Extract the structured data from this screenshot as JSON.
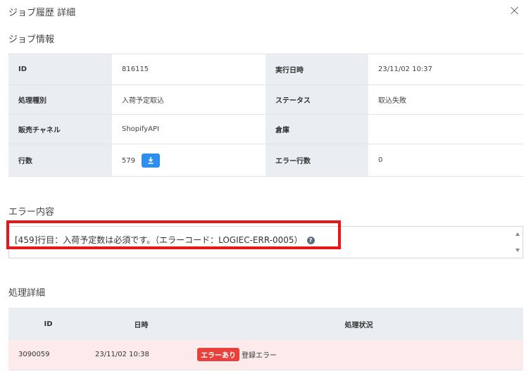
{
  "modal": {
    "title": "ジョブ履歴 詳細"
  },
  "job_info": {
    "section_title": "ジョブ情報",
    "rows": [
      {
        "label1": "ID",
        "value1": "816115",
        "label2": "実行日時",
        "value2": "23/11/02 10:37"
      },
      {
        "label1": "処理種別",
        "value1": "入荷予定取込",
        "label2": "ステータス",
        "value2": "取込失敗"
      },
      {
        "label1": "販売チャネル",
        "value1": "ShopifyAPI",
        "label2": "倉庫",
        "value2": ""
      },
      {
        "label1": "行数",
        "value1": "579",
        "label2": "エラー行数",
        "value2": "0"
      }
    ]
  },
  "error": {
    "section_title": "エラー内容",
    "message": "[459]行目：入荷予定数は必須です。（エラーコード：LOGIEC-ERR-0005）",
    "help_glyph": "?"
  },
  "detail": {
    "section_title": "処理詳細",
    "headers": {
      "id": "ID",
      "datetime": "日時",
      "status": "処理状況"
    },
    "rows": [
      {
        "id": "3090059",
        "datetime": "23/11/02 10:38",
        "badge": "エラーあり",
        "status_text": "登録エラー"
      }
    ]
  },
  "colors": {
    "accent": "#2d8ef0",
    "error_badge": "#e8413b",
    "highlight": "#e8151a",
    "error_row_bg": "#fdeaea"
  }
}
